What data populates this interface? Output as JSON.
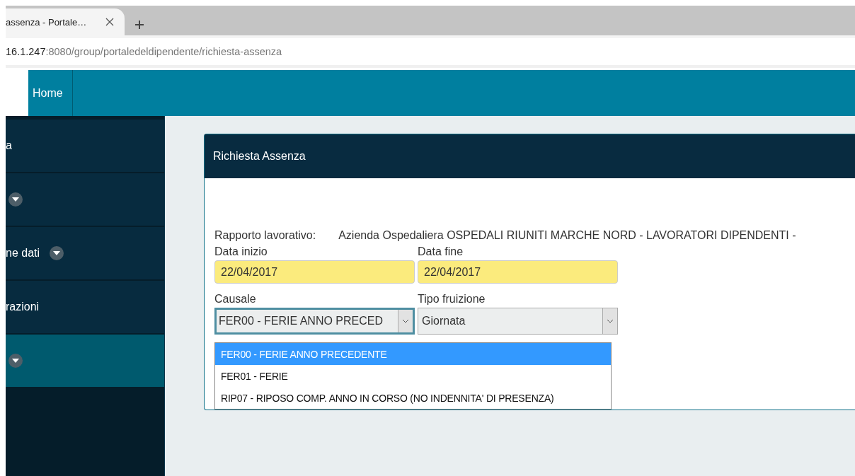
{
  "browser": {
    "tab": {
      "title": "assenza - Portale…"
    },
    "address": {
      "host": "16.1.247",
      "path": ":8080/group/portaledeldipendente/richiesta-assenza"
    }
  },
  "header": {
    "nav": [
      {
        "label": "Home",
        "selected": false
      }
    ]
  },
  "sidebar": {
    "items": [
      {
        "label": "a",
        "expandable": false,
        "selected": false
      },
      {
        "expandable": true,
        "selected": false
      },
      {
        "label": "ne dati",
        "expandable": true,
        "selected": false
      },
      {
        "label": "razioni",
        "expandable": false,
        "selected": false
      },
      {
        "expandable": true,
        "selected": true
      }
    ]
  },
  "panel": {
    "title": "Richiesta Assenza",
    "rapporto": {
      "label": "Rapporto lavorativo:",
      "value": "Azienda Ospedaliera OSPEDALI RIUNITI MARCHE NORD - LAVORATORI DIPENDENTI -"
    },
    "fields": [
      {
        "kind": "date",
        "label": "Data inizio",
        "value": "22/04/2017"
      },
      {
        "kind": "date",
        "label": "Data fine",
        "value": "22/04/2017"
      },
      {
        "kind": "select",
        "label": "Causale",
        "value": "FER00 - FERIE ANNO PRECED",
        "focused": true,
        "options": [
          {
            "label": "FER00 - FERIE ANNO PRECEDENTE",
            "selected": true
          },
          {
            "label": "FER01 - FERIE",
            "selected": false
          },
          {
            "label": "RIP07 - RIPOSO COMP. ANNO IN CORSO (NO INDENNITA' DI PRESENZA)",
            "selected": false
          }
        ]
      },
      {
        "kind": "select",
        "label": "Tipo fruizione",
        "value": "Giornata",
        "focused": false
      }
    ]
  }
}
